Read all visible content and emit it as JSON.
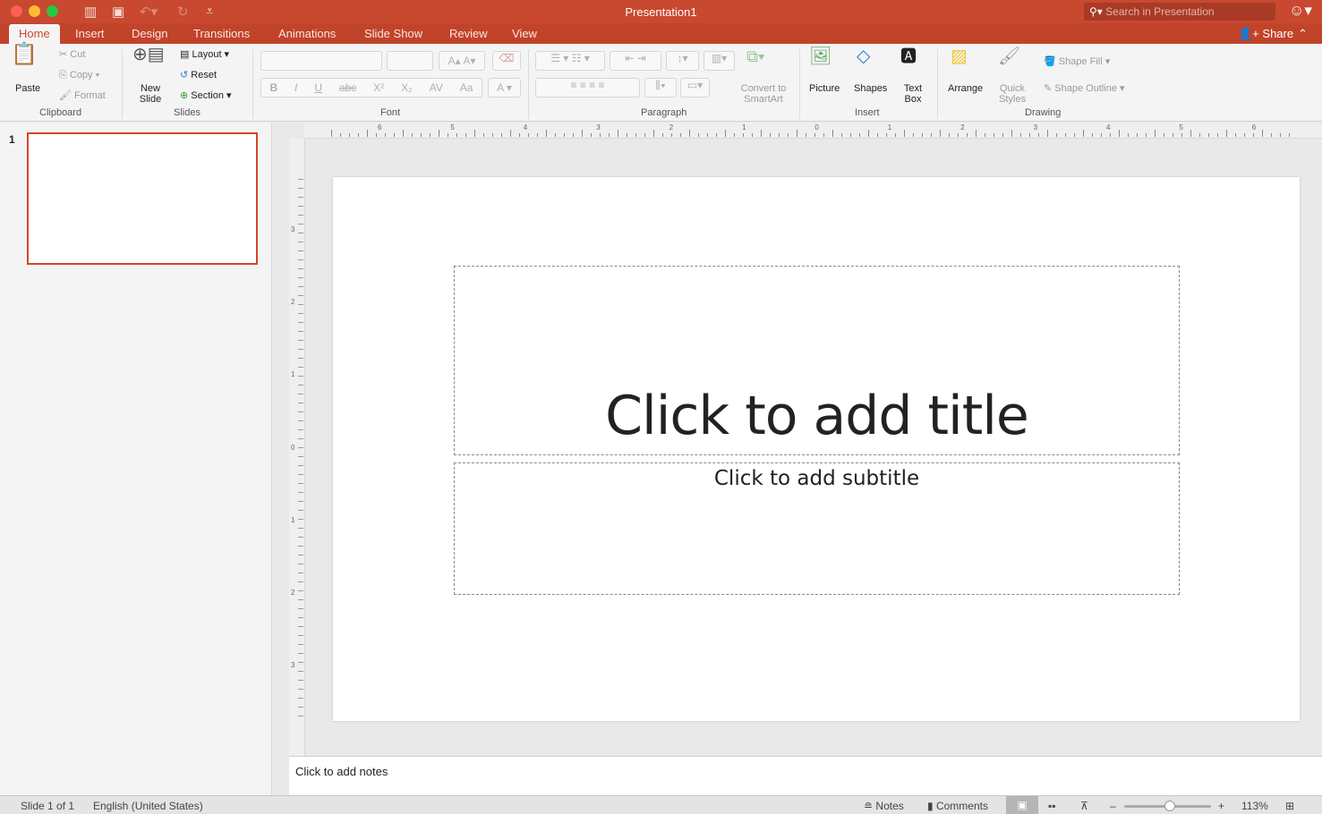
{
  "window": {
    "title": "Presentation1",
    "search_placeholder": "Search in Presentation",
    "share_label": "Share"
  },
  "tabs": [
    "Home",
    "Insert",
    "Design",
    "Transitions",
    "Animations",
    "Slide Show",
    "Review",
    "View"
  ],
  "ribbon": {
    "clipboard": {
      "paste": "Paste",
      "cut": "Cut",
      "copy": "Copy",
      "format": "Format",
      "label": "Clipboard"
    },
    "slides": {
      "new_slide": "New Slide",
      "layout": "Layout",
      "reset": "Reset",
      "section": "Section",
      "label": "Slides"
    },
    "font": {
      "label": "Font",
      "bold": "B",
      "italic": "I",
      "underline": "U",
      "strike": "abc",
      "superscript": "X²",
      "subscript": "X₂",
      "spacing": "AV",
      "case": "Aa",
      "color": "A",
      "grow": "A▴",
      "shrink": "A▾"
    },
    "paragraph": {
      "label": "Paragraph",
      "convert_smartart": "Convert to SmartArt"
    },
    "insert": {
      "label": "Insert",
      "picture": "Picture",
      "shapes": "Shapes",
      "text_box": "Text Box"
    },
    "drawing": {
      "label": "Drawing",
      "arrange": "Arrange",
      "quick_styles": "Quick Styles",
      "shape_fill": "Shape Fill",
      "shape_outline": "Shape Outline"
    }
  },
  "thumbnails": [
    {
      "number": "1"
    }
  ],
  "rulers": {
    "horizontal": [
      "6",
      "5",
      "4",
      "3",
      "2",
      "1",
      "0",
      "1",
      "2",
      "3",
      "4",
      "5",
      "6"
    ],
    "vertical": [
      "3",
      "2",
      "1",
      "0",
      "1",
      "2",
      "3"
    ]
  },
  "slide": {
    "title_placeholder": "Click to add title",
    "subtitle_placeholder": "Click to add subtitle"
  },
  "notes_placeholder": "Click to add notes",
  "status": {
    "slide_count": "Slide 1 of 1",
    "language": "English (United States)",
    "notes": "Notes",
    "comments": "Comments",
    "zoom": "113%",
    "zoom_level_percent": 113
  },
  "colors": {
    "accent": "#c8492f",
    "selection": "#d24726"
  }
}
